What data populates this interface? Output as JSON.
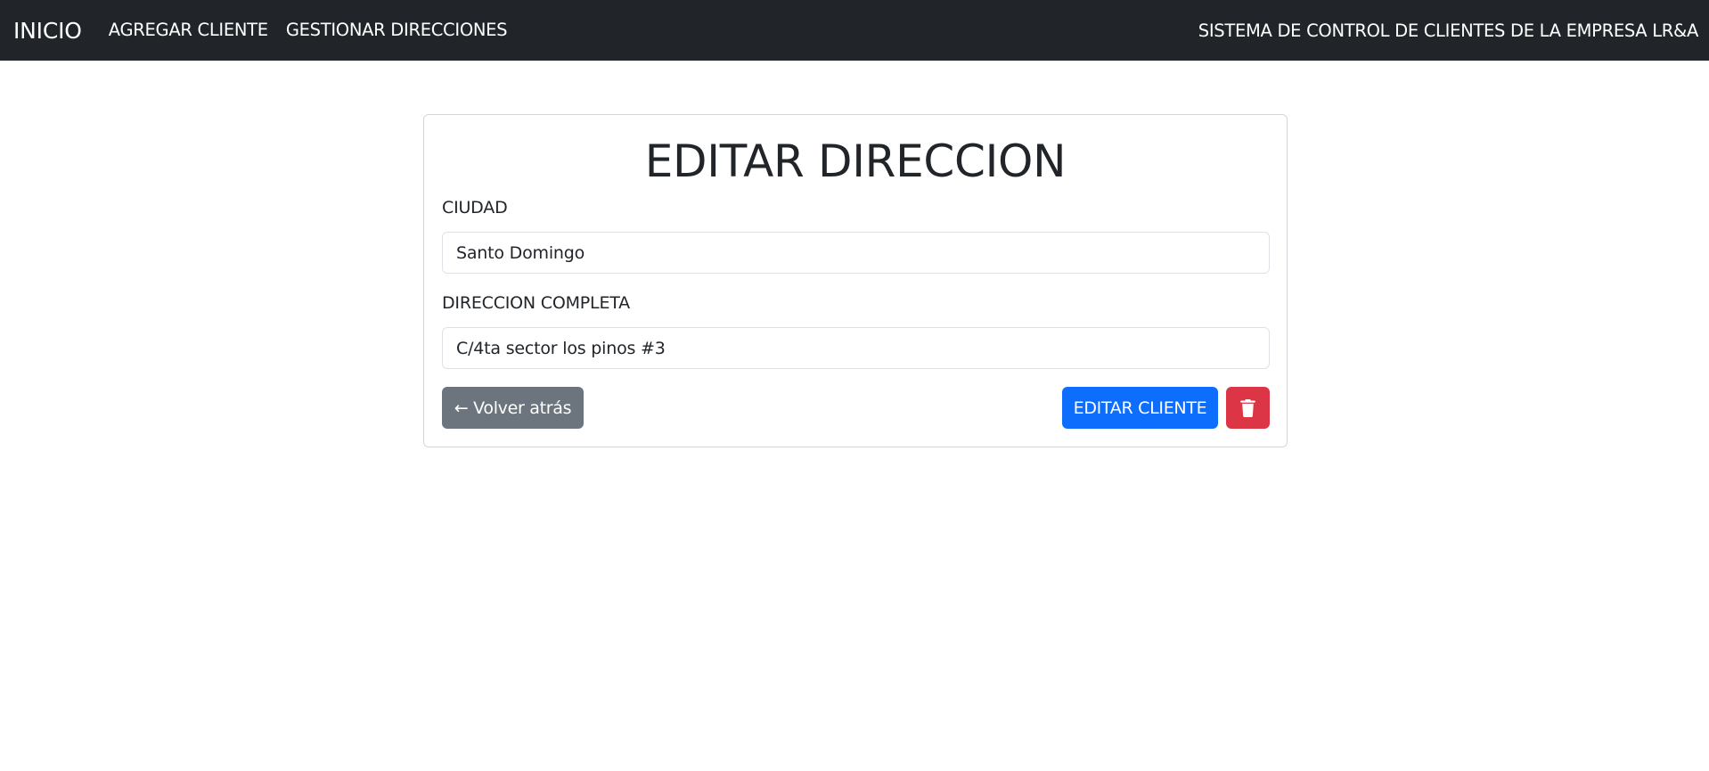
{
  "navbar": {
    "brand": "INICIO",
    "links": [
      "AGREGAR CLIENTE",
      "GESTIONAR DIRECCIONES"
    ],
    "right_text": "SISTEMA DE CONTROL DE CLIENTES DE LA EMPRESA LR&A"
  },
  "form": {
    "title": "EDITAR DIRECCION",
    "city_label": "CIUDAD",
    "city_value": "Santo Domingo",
    "address_label": "DIRECCION COMPLETA",
    "address_value": "C/4ta sector los pinos #3",
    "back_label": "← Volver atrás",
    "edit_label": "EDITAR CLIENTE",
    "delete_icon": "trash-icon"
  },
  "colors": {
    "navbar_bg": "#212529",
    "primary": "#0d6efd",
    "secondary": "#6c757d",
    "danger": "#dc3545"
  }
}
